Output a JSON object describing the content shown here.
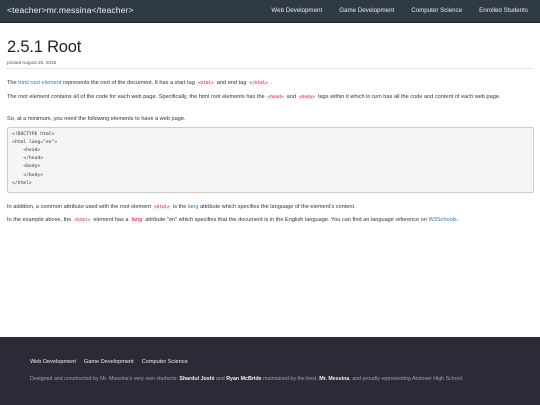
{
  "navbar": {
    "brand": "<teacher>mr.messina</teacher>",
    "links": [
      "Web Development",
      "Game Development",
      "Computer Science",
      "Enrolled Students"
    ]
  },
  "post": {
    "title": "2.5.1 Root",
    "date": "posted August 25, 2015",
    "p1": {
      "link": "html root element",
      "t1": " represents the root of the document. It has a start tag ",
      "tag1": "<html>",
      "t2": " and end tag ",
      "tag2": "</html>",
      "t3": "."
    },
    "p2": {
      "t1": "The root element contains all of the code for each web page. Specifically, the html root elements has the ",
      "tag1": "<head>",
      "t2": " and ",
      "tag2": "<body>",
      "t3": " tags within it which in turn has all the code and content of each web page."
    },
    "p3": "So, at a minimum, you need the following elements to have a web page.",
    "code_lines": [
      "<!DOCTYPE html>",
      "<html lang=\"en\">",
      "    <head>",
      "    </head>",
      "    <body>",
      "    </body>",
      "</html>"
    ],
    "p4": {
      "t1": "In addition, a common attribute used with the root element ",
      "tag1": "<html>",
      "t2": " is the ",
      "link": "lang",
      "t3": " attribute which specifies the language of the element's content."
    },
    "p5": {
      "t1": "In the example above, the ",
      "tag1": "<html>",
      "t2": " element has a ",
      "tag2": "lang",
      "t3": " attribute \"en\" which specifies that the document is in the English language. You can find an language reference on ",
      "link": "W3Schools",
      "t4": "."
    }
  },
  "footer": {
    "links": [
      "Web Development",
      "Game Development",
      "Computer Science"
    ],
    "credit": {
      "t1": "Designed and constructed by Mr. Messina's very own students: ",
      "name1": "Shardul Joshi",
      "t2": " and ",
      "name2": "Ryan McBride",
      "t3": " maintained by the best, ",
      "name3": "Mr. Messina",
      "t4": ", and proudly representing Andover High School."
    }
  }
}
